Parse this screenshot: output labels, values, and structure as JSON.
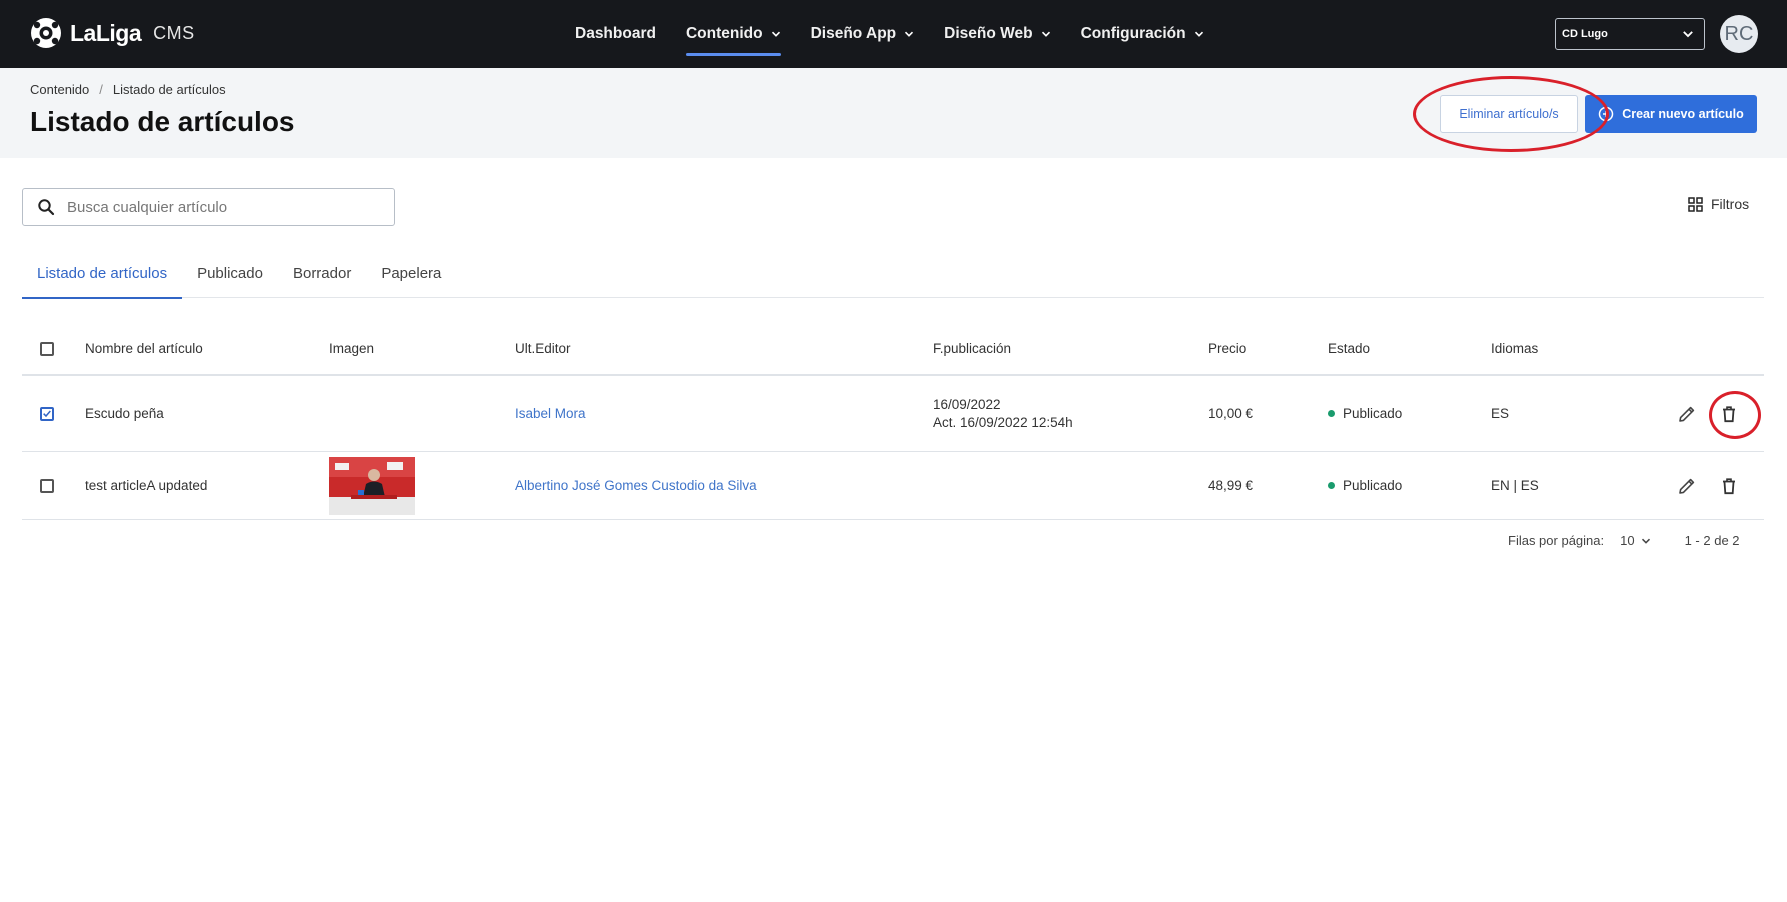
{
  "app": {
    "logo_text": "LaLiga",
    "logo_suffix": "CMS"
  },
  "nav": {
    "items": [
      {
        "label": "Dashboard",
        "has_dropdown": false,
        "active": false
      },
      {
        "label": "Contenido",
        "has_dropdown": true,
        "active": true
      },
      {
        "label": "Diseño App",
        "has_dropdown": true,
        "active": false
      },
      {
        "label": "Diseño Web",
        "has_dropdown": true,
        "active": false
      },
      {
        "label": "Configuración",
        "has_dropdown": true,
        "active": false
      }
    ],
    "club_select": "CD Lugo",
    "avatar_initials": "RC"
  },
  "header": {
    "breadcrumb": [
      "Contenido",
      "Listado de artículos"
    ],
    "breadcrumb_sep": "/",
    "title": "Listado de artículos",
    "delete_button": "Eliminar artículo/s",
    "create_button": "Crear nuevo artículo"
  },
  "search": {
    "placeholder": "Busca cualquier artículo",
    "value": ""
  },
  "filters_label": "Filtros",
  "tabs": [
    {
      "label": "Listado de artículos",
      "active": true
    },
    {
      "label": "Publicado",
      "active": false
    },
    {
      "label": "Borrador",
      "active": false
    },
    {
      "label": "Papelera",
      "active": false
    }
  ],
  "table": {
    "columns": [
      "Nombre del artículo",
      "Imagen",
      "Ult.Editor",
      "F.publicación",
      "Precio",
      "Estado",
      "Idiomas"
    ],
    "rows": [
      {
        "checked": true,
        "name": "Escudo peña",
        "has_image": false,
        "editor": "Isabel Mora",
        "date": "16/09/2022",
        "updated": "Act. 16/09/2022 12:54h",
        "price": "10,00 €",
        "status": "Publicado",
        "languages": "ES"
      },
      {
        "checked": false,
        "name": "test articleA updated",
        "has_image": true,
        "editor": "Albertino José Gomes Custodio da Silva",
        "date": "",
        "updated": "",
        "price": "48,99 €",
        "status": "Publicado",
        "languages": "EN | ES"
      }
    ]
  },
  "pagination": {
    "rows_per_page_label": "Filas por página:",
    "rows_per_page": "10",
    "range": "1 - 2 de 2"
  },
  "colors": {
    "topbar": "#16181c",
    "accent": "#2f6edb",
    "link": "#3f74c9",
    "status_published": "#1a9b6d",
    "annotation": "#d9202a"
  }
}
